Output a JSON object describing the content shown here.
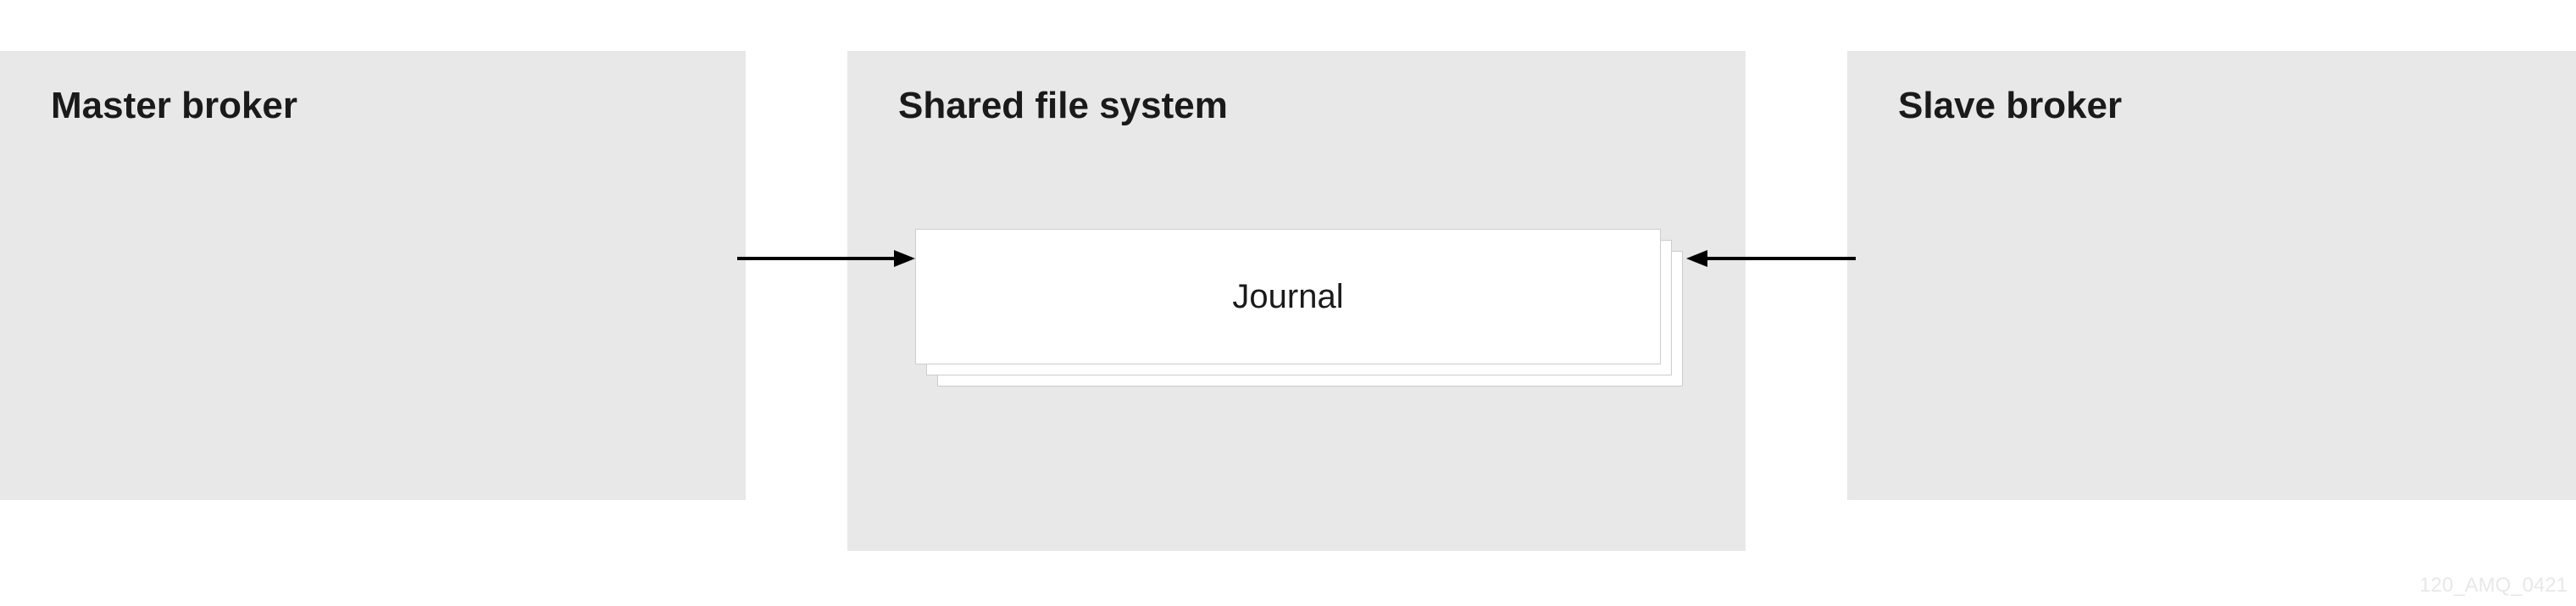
{
  "boxes": {
    "master": {
      "title": "Master broker"
    },
    "shared": {
      "title": "Shared file system",
      "journal": "Journal"
    },
    "slave": {
      "title": "Slave broker"
    }
  },
  "footer_id": "120_AMQ_0421"
}
